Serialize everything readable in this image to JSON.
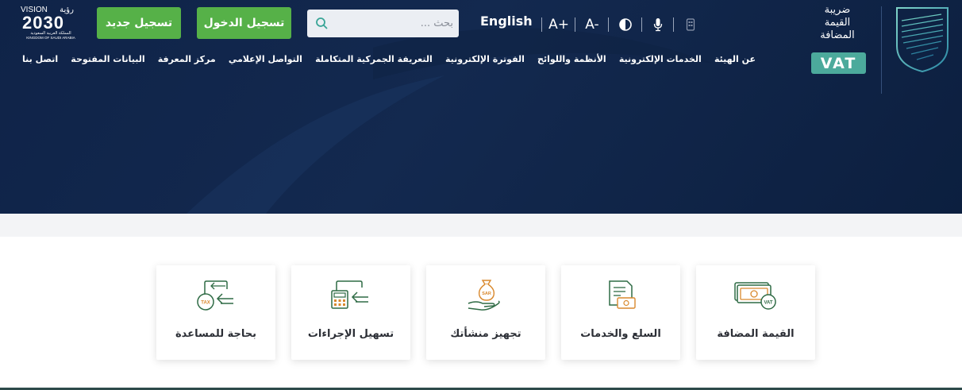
{
  "header": {
    "register_label": "تسجيل جديد",
    "login_label": "تسجيل الدخول",
    "search_placeholder": "بحث ...",
    "language_label": "English",
    "font_increase": "A+",
    "font_decrease": "A-",
    "brand_line1": "ضريبة",
    "brand_line2": "القيمة",
    "brand_line3": "المضافة",
    "vat_badge": "VAT",
    "vision_title": "VISION",
    "vision_number": "2030",
    "vision_ar": "رؤية",
    "vision_sub_ar": "المملكة العربية السعودية",
    "vision_sub_en": "KINGDOM OF SAUDI ARABIA"
  },
  "nav": {
    "items": [
      "عن الهيئة",
      "الخدمات الإلكترونية",
      "الأنظمة واللوائح",
      "الفوترة الإلكترونية",
      "التعريفة الجمركية المتكاملة",
      "التواصل الإعلامي",
      "مركز المعرفة",
      "البيانات المفتوحة",
      "اتصل بنا"
    ]
  },
  "cards": [
    {
      "label": "القيمة المضافة",
      "icon": "vat-money-icon"
    },
    {
      "label": "السلع والخدمات",
      "icon": "goods-services-icon"
    },
    {
      "label": "تجهيز منشأتك",
      "icon": "sar-money-bag-icon"
    },
    {
      "label": "تسهيل الإجراءات",
      "icon": "calculator-arrow-icon"
    },
    {
      "label": "بحاجة للمساعدة",
      "icon": "tax-help-icon"
    }
  ],
  "icons": {
    "money_tag": "SAR",
    "tax_tag": "TAX",
    "vat_tag": "VAT"
  },
  "colors": {
    "hero": "#13294f",
    "button_green": "#56b148",
    "vat_teal": "#4caa9c",
    "icon_green": "#2f6b45",
    "icon_orange": "#d9892e"
  }
}
